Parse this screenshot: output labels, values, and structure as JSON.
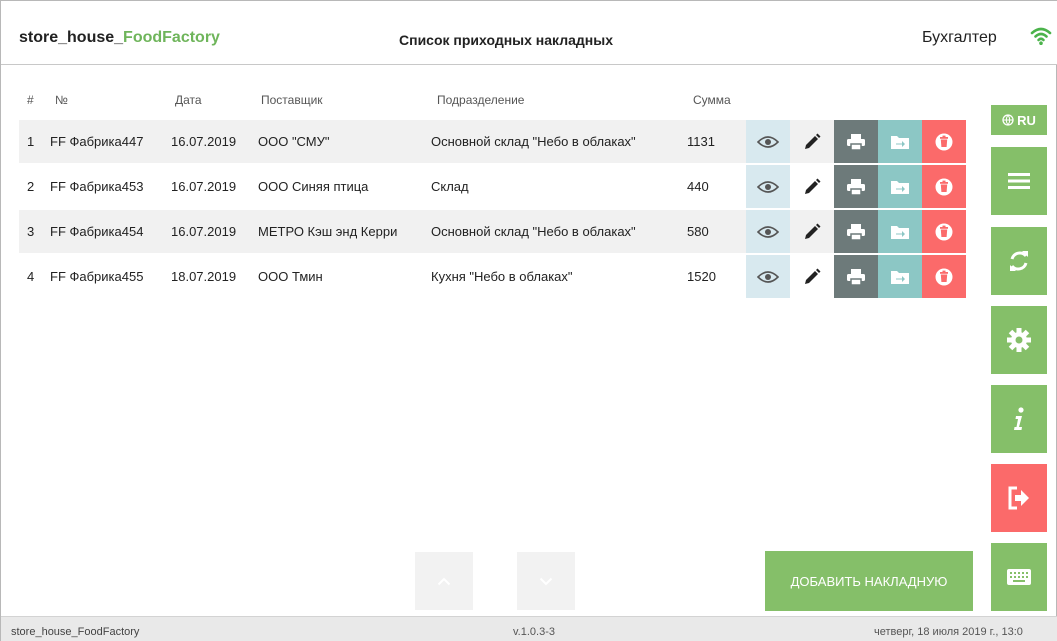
{
  "header": {
    "logo_prefix": "store_house_",
    "logo_accent": "FoodFactory",
    "title": "Список приходных накладных",
    "user_role": "Бухгалтер",
    "wifi_icon": "wifi-icon"
  },
  "table": {
    "columns": [
      "#",
      "№",
      "Дата",
      "Поставщик",
      "Подразделение",
      "Сумма"
    ],
    "rows": [
      {
        "idx": "1",
        "number": "FF Фабрика447",
        "date": "16.07.2019",
        "supplier": "ООО \"СМУ\"",
        "department": "Основной склад \"Небо в облаках\"",
        "sum": "1131"
      },
      {
        "idx": "2",
        "number": "FF Фабрика453",
        "date": "16.07.2019",
        "supplier": "ООО Синяя птица",
        "department": "Склад",
        "sum": "440"
      },
      {
        "idx": "3",
        "number": "FF Фабрика454",
        "date": "16.07.2019",
        "supplier": "МЕТРО Кэш энд Керри",
        "department": "Основной склад \"Небо в облаках\"",
        "sum": "580"
      },
      {
        "idx": "4",
        "number": "FF Фабрика455",
        "date": "18.07.2019",
        "supplier": "ООО Тмин",
        "department": "Кухня \"Небо в облаках\"",
        "sum": "1520"
      }
    ],
    "row_actions": [
      "eye-icon",
      "pencil-icon",
      "printer-icon",
      "folder-export-icon",
      "trash-icon"
    ]
  },
  "sidebar": {
    "lang_label": "RU",
    "items": [
      "menu-icon",
      "refresh-icon",
      "gear-icon",
      "info-icon",
      "logout-icon",
      "keyboard-icon"
    ]
  },
  "actions": {
    "add_label": "ДОБАВИТЬ НАКЛАДНУЮ"
  },
  "footer": {
    "app": "store_house_FoodFactory",
    "version": "v.1.0.3-3",
    "datetime": "четверг, 18 июля 2019 г., 13:0"
  },
  "colors": {
    "accent_green": "#85bf69",
    "danger_red": "#fb6a6a",
    "print_gray": "#6d7a7a",
    "export_teal": "#8cc7c5",
    "view_blue": "#d8e9ef"
  }
}
